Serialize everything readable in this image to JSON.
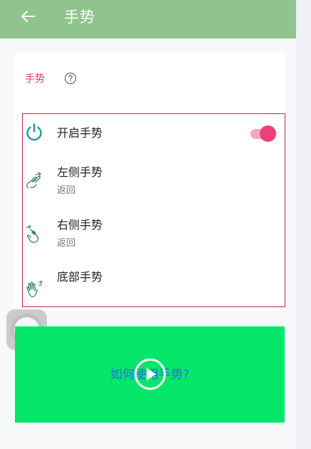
{
  "header": {
    "title": "手势"
  },
  "section": {
    "label": "手势"
  },
  "gestures": {
    "enable": {
      "label": "开启手势",
      "enabled": true
    },
    "left": {
      "label": "左侧手势",
      "action": "返回"
    },
    "right": {
      "label": "右侧手势",
      "action": "返回"
    },
    "bottom": {
      "label": "底部手势"
    }
  },
  "tutorial": {
    "caption": "如何使用手势?"
  },
  "colors": {
    "appbar": "#8fc58c",
    "section_label": "#d33a7d",
    "icon_teal": "#1e9a96",
    "toggle_on": "#ee3f77",
    "highlight_border": "#c8253a",
    "video_bg": "#06e66a",
    "caption": "#2a6be0"
  },
  "icons": {
    "back": "arrow-left-icon",
    "help": "question-circle-icon",
    "enable": "power-icon",
    "left": "swipe-left-hand-icon",
    "right": "swipe-right-hand-icon",
    "bottom": "swipe-up-hand-icon",
    "play": "play-circle-icon"
  }
}
